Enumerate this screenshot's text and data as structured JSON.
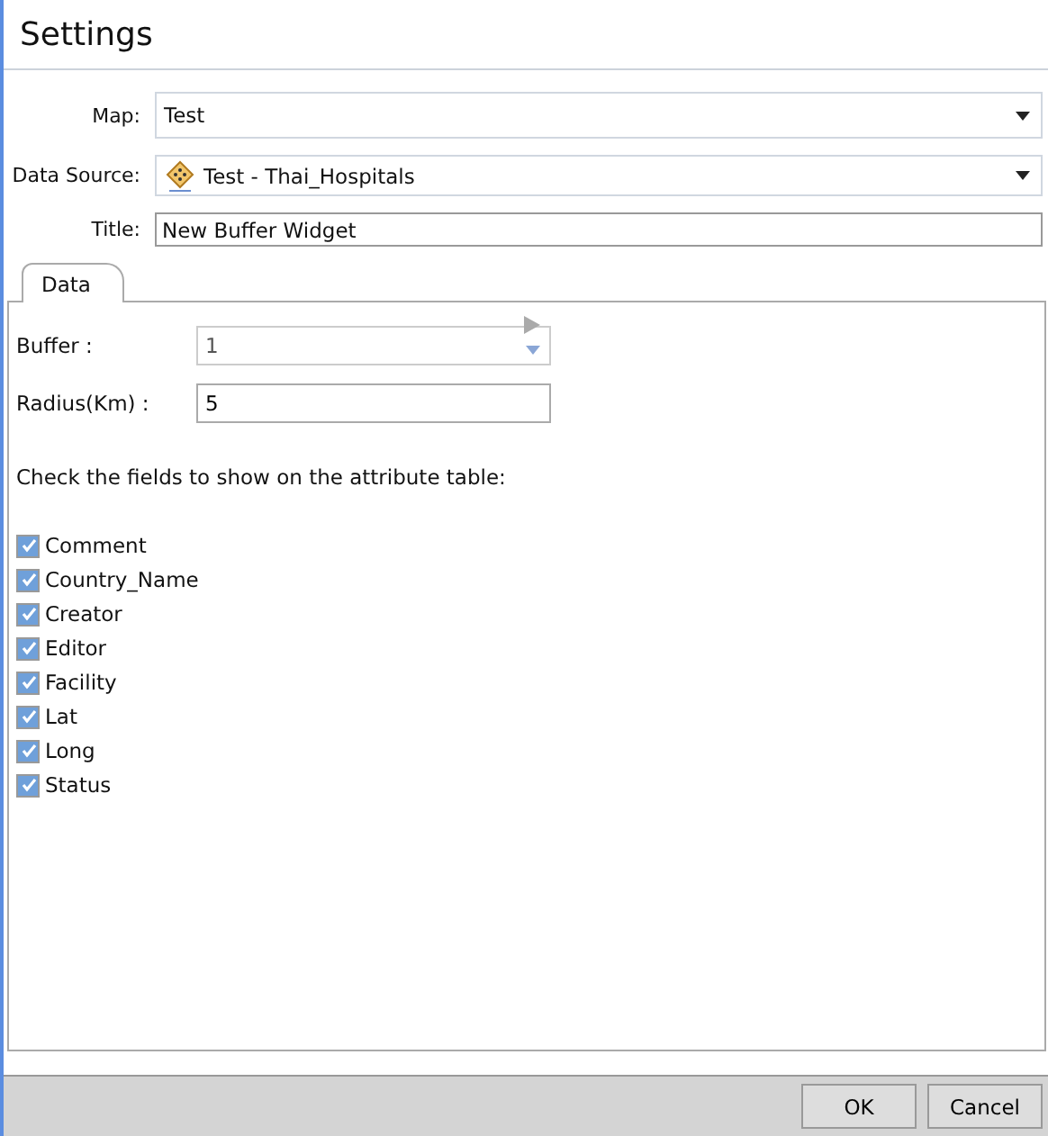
{
  "window": {
    "title": "Settings"
  },
  "form": [
    {
      "kind": "select",
      "label": "Map:",
      "value": "Test"
    },
    {
      "kind": "select-icon",
      "label": "Data Source:",
      "value": "Test - Thai_Hospitals"
    },
    {
      "kind": "text",
      "label": "Title:",
      "value": "New Buffer Widget"
    }
  ],
  "tabs": [
    {
      "label": "Data",
      "selected": true
    }
  ],
  "data": {
    "inputs": [
      {
        "kind": "spinner",
        "label": "Buffer :",
        "value": "1"
      },
      {
        "kind": "text",
        "label": "Radius(Km) :",
        "value": "5"
      }
    ],
    "instruction": "Check the fields to show on the attribute table:",
    "fields": [
      {
        "label": "Comment",
        "checked": true
      },
      {
        "label": "Country_Name",
        "checked": true
      },
      {
        "label": "Creator",
        "checked": true
      },
      {
        "label": "Editor",
        "checked": true
      },
      {
        "label": "Facility",
        "checked": true
      },
      {
        "label": "Lat",
        "checked": true
      },
      {
        "label": "Long",
        "checked": true
      },
      {
        "label": "Status",
        "checked": true
      }
    ]
  },
  "buttons": [
    "OK",
    "Cancel"
  ]
}
